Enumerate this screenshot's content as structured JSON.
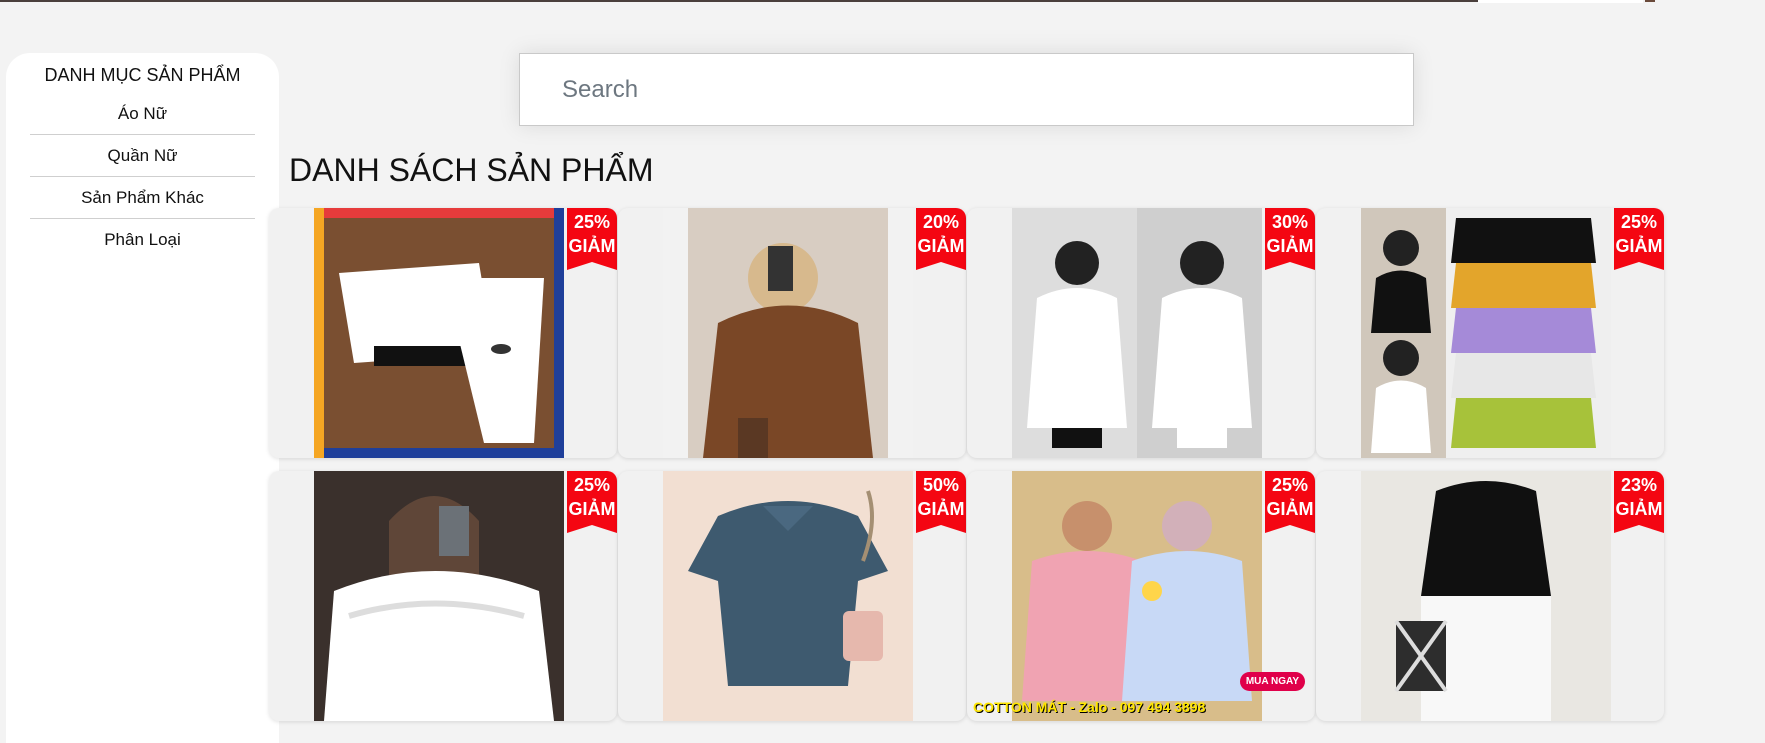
{
  "sidebar": {
    "title": "DANH MỤC SẢN PHẨM",
    "items": [
      {
        "label": "Áo Nữ"
      },
      {
        "label": "Quần Nữ"
      },
      {
        "label": "Sản Phẩm Khác"
      },
      {
        "label": "Phân Loại"
      }
    ]
  },
  "search": {
    "placeholder": "Search"
  },
  "main": {
    "title": "DANH SÁCH SẢN PHẨM",
    "products": [
      {
        "discount": "25%",
        "discount_label": "GIẢM"
      },
      {
        "discount": "20%",
        "discount_label": "GIẢM"
      },
      {
        "discount": "30%",
        "discount_label": "GIẢM"
      },
      {
        "discount": "25%",
        "discount_label": "GIẢM"
      },
      {
        "discount": "25%",
        "discount_label": "GIẢM"
      },
      {
        "discount": "50%",
        "discount_label": "GIẢM"
      },
      {
        "discount": "25%",
        "discount_label": "GIẢM",
        "photo_caption": "COTTON MÁT - Zalo - 097 494 3898",
        "photo_sticker": "MUA NGAY"
      },
      {
        "discount": "23%",
        "discount_label": "GIẢM"
      }
    ]
  },
  "colors": {
    "badge_red": "#f40612",
    "page_bg": "#f3f3f3",
    "top_rule": "#4a3f3c"
  }
}
